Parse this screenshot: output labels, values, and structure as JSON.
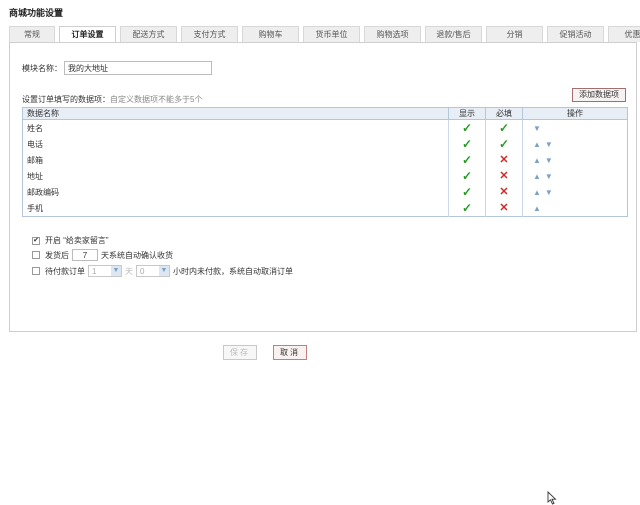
{
  "page_title": "商城功能设置",
  "tabs": [
    {
      "label": "常规"
    },
    {
      "label": "订单设置"
    },
    {
      "label": "配送方式"
    },
    {
      "label": "支付方式"
    },
    {
      "label": "购物车"
    },
    {
      "label": "货币单位"
    },
    {
      "label": "购物选项"
    },
    {
      "label": "退款/售后"
    },
    {
      "label": "分销"
    },
    {
      "label": "促销活动"
    },
    {
      "label": "优惠券"
    }
  ],
  "active_tab": 1,
  "module": {
    "label": "模块名称：",
    "value": "我的大地址"
  },
  "fields_hint": {
    "main": "设置订单填写的数据项：",
    "sub": "自定义数据项不能多于5个"
  },
  "add_button": "添加数据项",
  "table": {
    "headers": {
      "name": "数据名称",
      "show": "显示",
      "required": "必填",
      "ops": "操作"
    },
    "rows": [
      {
        "name": "姓名",
        "show": true,
        "required": true,
        "up": false,
        "down": true
      },
      {
        "name": "电话",
        "show": true,
        "required": true,
        "up": true,
        "down": true
      },
      {
        "name": "邮箱",
        "show": true,
        "required": false,
        "up": true,
        "down": true
      },
      {
        "name": "地址",
        "show": true,
        "required": false,
        "up": true,
        "down": true
      },
      {
        "name": "邮政编码",
        "show": true,
        "required": false,
        "up": true,
        "down": true
      },
      {
        "name": "手机",
        "show": true,
        "required": false,
        "up": true,
        "down": false
      }
    ]
  },
  "options": {
    "seller_note": {
      "checked": true,
      "label": "开启 “给卖家留言”"
    },
    "auto_confirm": {
      "checked": false,
      "before": "发货后",
      "days": "7",
      "after": "天系统自动确认收货"
    },
    "auto_cancel": {
      "checked": false,
      "before": "待付款订单",
      "day_value": "1",
      "day_unit": "天",
      "hour_value": "0",
      "after": "小时内未付款，系统自动取消订单"
    }
  },
  "buttons": {
    "save": "保存",
    "cancel": "取消"
  }
}
